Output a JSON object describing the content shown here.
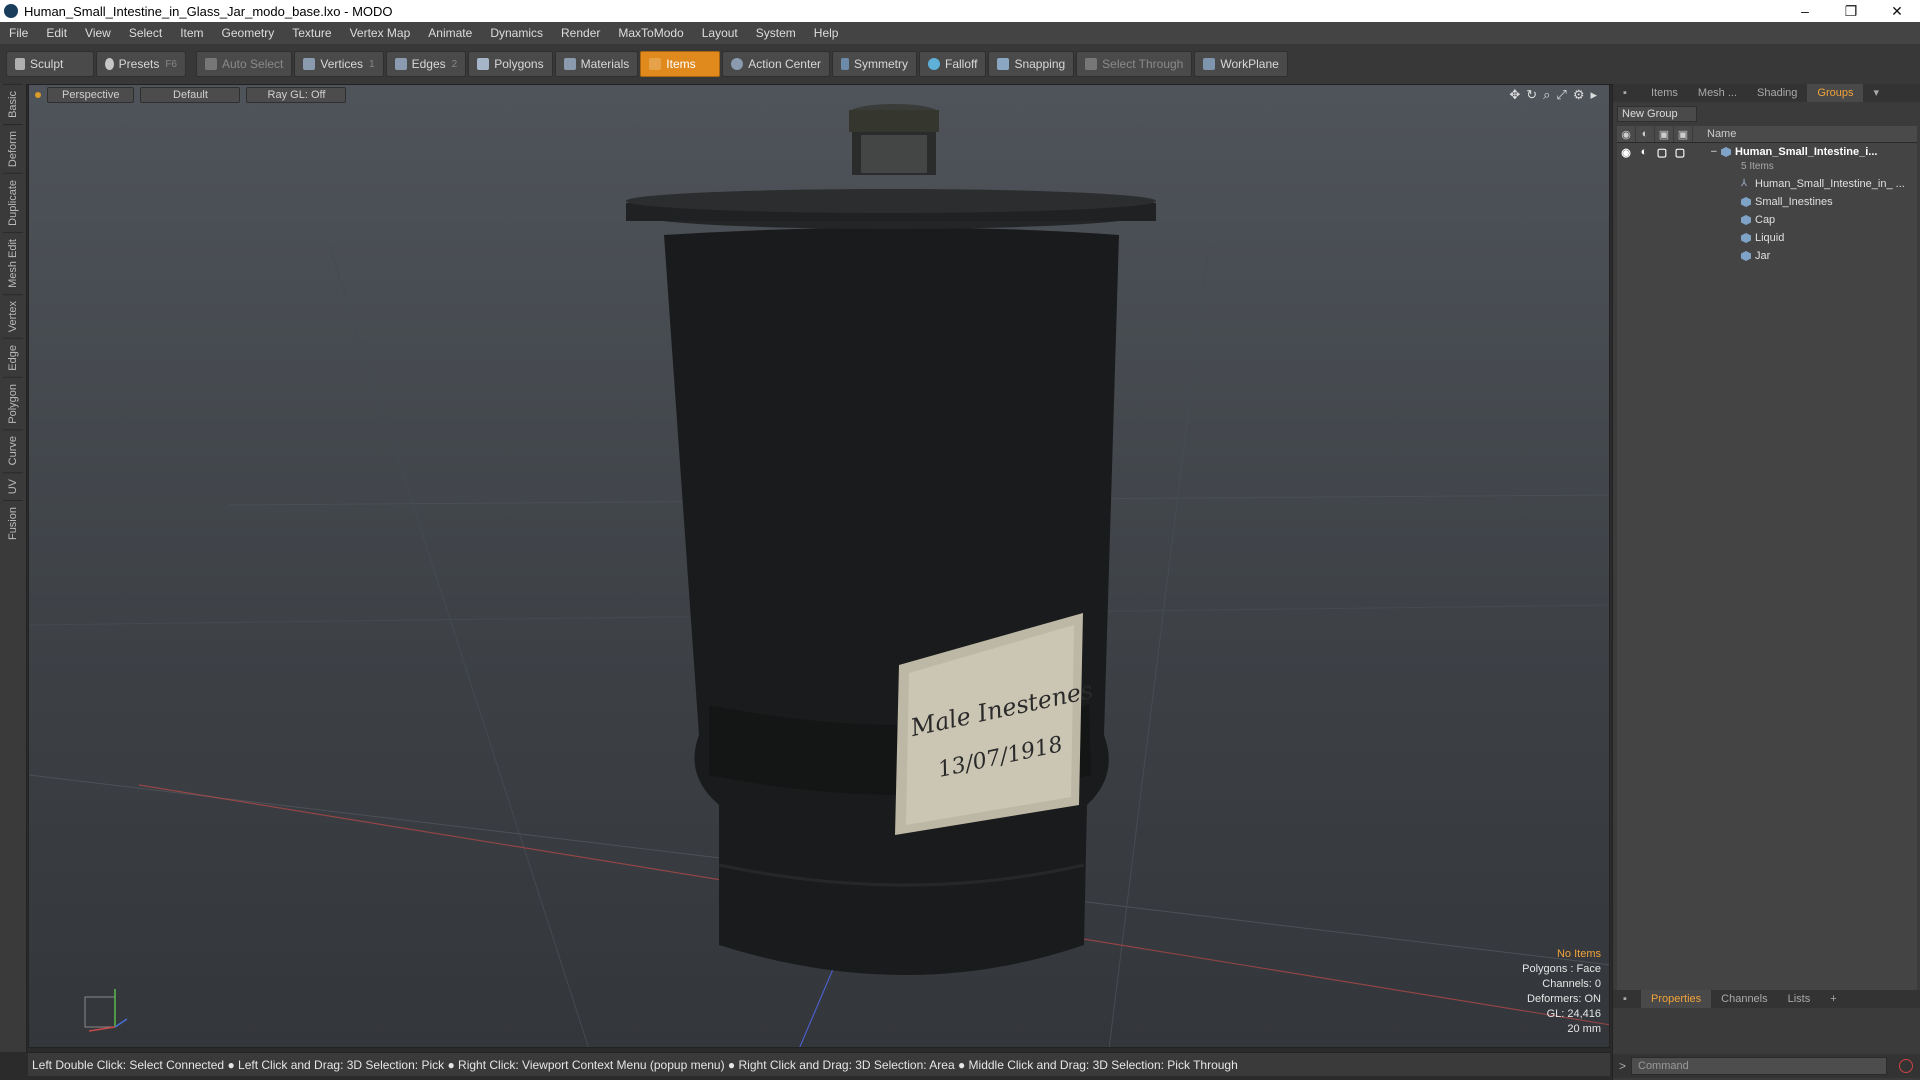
{
  "window": {
    "title": "Human_Small_Intestine_in_Glass_Jar_modo_base.lxo - MODO",
    "controls": [
      "–",
      "❐",
      "✕"
    ]
  },
  "menu": [
    "File",
    "Edit",
    "View",
    "Select",
    "Item",
    "Geometry",
    "Texture",
    "Vertex Map",
    "Animate",
    "Dynamics",
    "Render",
    "MaxToModo",
    "Layout",
    "System",
    "Help"
  ],
  "toolbar": {
    "sculpt": "Sculpt",
    "presets": "Presets",
    "presets_key": "F6",
    "auto_select": "Auto Select",
    "vertices": "Vertices",
    "vertices_key": "1",
    "edges": "Edges",
    "edges_key": "2",
    "polygons": "Polygons",
    "materials": "Materials",
    "items": "Items",
    "action_center": "Action Center",
    "symmetry": "Symmetry",
    "falloff": "Falloff",
    "snapping": "Snapping",
    "select_through": "Select Through",
    "workplane": "WorkPlane"
  },
  "left_tabs": [
    "Basic",
    "Deform",
    "Duplicate",
    "Mesh Edit",
    "Vertex",
    "Edge",
    "Polygon",
    "Curve",
    "UV",
    "Fusion"
  ],
  "viewport": {
    "view": "Perspective",
    "shading": "Default",
    "raygl": "Ray GL: Off",
    "label_line1": "Male Inestenes",
    "label_line2": "13/07/1918",
    "info": {
      "selection": "No Items",
      "polygons": "Polygons : Face",
      "channels": "Channels: 0",
      "deformers": "Deformers: ON",
      "gl": "GL: 24,416",
      "scale": "20 mm"
    }
  },
  "status": "Left Double Click: Select Connected ● Left Click and Drag: 3D Selection: Pick ● Right Click: Viewport Context Menu (popup menu) ● Right Click and Drag: 3D Selection: Area ● Middle Click and Drag: 3D Selection: Pick Through",
  "right_panel": {
    "tabs": [
      "Items",
      "Mesh ...",
      "Shading",
      "Groups"
    ],
    "new_group": "New Group",
    "name_col": "Name",
    "root": "Human_Small_Intestine_i...",
    "root_sub": "5 Items",
    "children": [
      "Human_Small_Intestine_in_ ...",
      "Small_Inestines",
      "Cap",
      "Liquid",
      "Jar"
    ],
    "bottom_tabs": [
      "Properties",
      "Channels",
      "Lists"
    ],
    "command_placeholder": "Command"
  },
  "colors": {
    "accent": "#e08a1e",
    "warn": "#f2a33a"
  }
}
